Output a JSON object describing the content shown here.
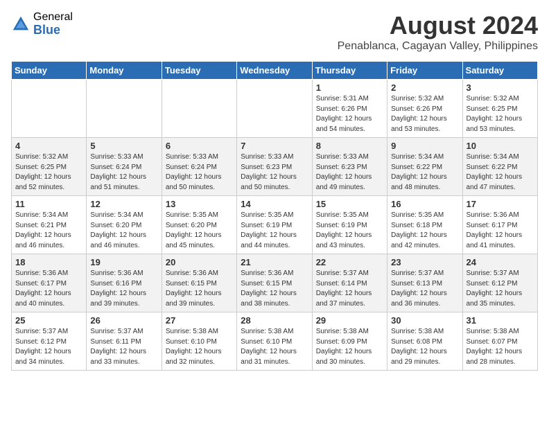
{
  "header": {
    "logo_general": "General",
    "logo_blue": "Blue",
    "month": "August 2024",
    "location": "Penablanca, Cagayan Valley, Philippines"
  },
  "days": [
    "Sunday",
    "Monday",
    "Tuesday",
    "Wednesday",
    "Thursday",
    "Friday",
    "Saturday"
  ],
  "weeks": [
    [
      {
        "day": "",
        "info": ""
      },
      {
        "day": "",
        "info": ""
      },
      {
        "day": "",
        "info": ""
      },
      {
        "day": "",
        "info": ""
      },
      {
        "day": "1",
        "info": "Sunrise: 5:31 AM\nSunset: 6:26 PM\nDaylight: 12 hours\nand 54 minutes."
      },
      {
        "day": "2",
        "info": "Sunrise: 5:32 AM\nSunset: 6:26 PM\nDaylight: 12 hours\nand 53 minutes."
      },
      {
        "day": "3",
        "info": "Sunrise: 5:32 AM\nSunset: 6:25 PM\nDaylight: 12 hours\nand 53 minutes."
      }
    ],
    [
      {
        "day": "4",
        "info": "Sunrise: 5:32 AM\nSunset: 6:25 PM\nDaylight: 12 hours\nand 52 minutes."
      },
      {
        "day": "5",
        "info": "Sunrise: 5:33 AM\nSunset: 6:24 PM\nDaylight: 12 hours\nand 51 minutes."
      },
      {
        "day": "6",
        "info": "Sunrise: 5:33 AM\nSunset: 6:24 PM\nDaylight: 12 hours\nand 50 minutes."
      },
      {
        "day": "7",
        "info": "Sunrise: 5:33 AM\nSunset: 6:23 PM\nDaylight: 12 hours\nand 50 minutes."
      },
      {
        "day": "8",
        "info": "Sunrise: 5:33 AM\nSunset: 6:23 PM\nDaylight: 12 hours\nand 49 minutes."
      },
      {
        "day": "9",
        "info": "Sunrise: 5:34 AM\nSunset: 6:22 PM\nDaylight: 12 hours\nand 48 minutes."
      },
      {
        "day": "10",
        "info": "Sunrise: 5:34 AM\nSunset: 6:22 PM\nDaylight: 12 hours\nand 47 minutes."
      }
    ],
    [
      {
        "day": "11",
        "info": "Sunrise: 5:34 AM\nSunset: 6:21 PM\nDaylight: 12 hours\nand 46 minutes."
      },
      {
        "day": "12",
        "info": "Sunrise: 5:34 AM\nSunset: 6:20 PM\nDaylight: 12 hours\nand 46 minutes."
      },
      {
        "day": "13",
        "info": "Sunrise: 5:35 AM\nSunset: 6:20 PM\nDaylight: 12 hours\nand 45 minutes."
      },
      {
        "day": "14",
        "info": "Sunrise: 5:35 AM\nSunset: 6:19 PM\nDaylight: 12 hours\nand 44 minutes."
      },
      {
        "day": "15",
        "info": "Sunrise: 5:35 AM\nSunset: 6:19 PM\nDaylight: 12 hours\nand 43 minutes."
      },
      {
        "day": "16",
        "info": "Sunrise: 5:35 AM\nSunset: 6:18 PM\nDaylight: 12 hours\nand 42 minutes."
      },
      {
        "day": "17",
        "info": "Sunrise: 5:36 AM\nSunset: 6:17 PM\nDaylight: 12 hours\nand 41 minutes."
      }
    ],
    [
      {
        "day": "18",
        "info": "Sunrise: 5:36 AM\nSunset: 6:17 PM\nDaylight: 12 hours\nand 40 minutes."
      },
      {
        "day": "19",
        "info": "Sunrise: 5:36 AM\nSunset: 6:16 PM\nDaylight: 12 hours\nand 39 minutes."
      },
      {
        "day": "20",
        "info": "Sunrise: 5:36 AM\nSunset: 6:15 PM\nDaylight: 12 hours\nand 39 minutes."
      },
      {
        "day": "21",
        "info": "Sunrise: 5:36 AM\nSunset: 6:15 PM\nDaylight: 12 hours\nand 38 minutes."
      },
      {
        "day": "22",
        "info": "Sunrise: 5:37 AM\nSunset: 6:14 PM\nDaylight: 12 hours\nand 37 minutes."
      },
      {
        "day": "23",
        "info": "Sunrise: 5:37 AM\nSunset: 6:13 PM\nDaylight: 12 hours\nand 36 minutes."
      },
      {
        "day": "24",
        "info": "Sunrise: 5:37 AM\nSunset: 6:12 PM\nDaylight: 12 hours\nand 35 minutes."
      }
    ],
    [
      {
        "day": "25",
        "info": "Sunrise: 5:37 AM\nSunset: 6:12 PM\nDaylight: 12 hours\nand 34 minutes."
      },
      {
        "day": "26",
        "info": "Sunrise: 5:37 AM\nSunset: 6:11 PM\nDaylight: 12 hours\nand 33 minutes."
      },
      {
        "day": "27",
        "info": "Sunrise: 5:38 AM\nSunset: 6:10 PM\nDaylight: 12 hours\nand 32 minutes."
      },
      {
        "day": "28",
        "info": "Sunrise: 5:38 AM\nSunset: 6:10 PM\nDaylight: 12 hours\nand 31 minutes."
      },
      {
        "day": "29",
        "info": "Sunrise: 5:38 AM\nSunset: 6:09 PM\nDaylight: 12 hours\nand 30 minutes."
      },
      {
        "day": "30",
        "info": "Sunrise: 5:38 AM\nSunset: 6:08 PM\nDaylight: 12 hours\nand 29 minutes."
      },
      {
        "day": "31",
        "info": "Sunrise: 5:38 AM\nSunset: 6:07 PM\nDaylight: 12 hours\nand 28 minutes."
      }
    ]
  ]
}
